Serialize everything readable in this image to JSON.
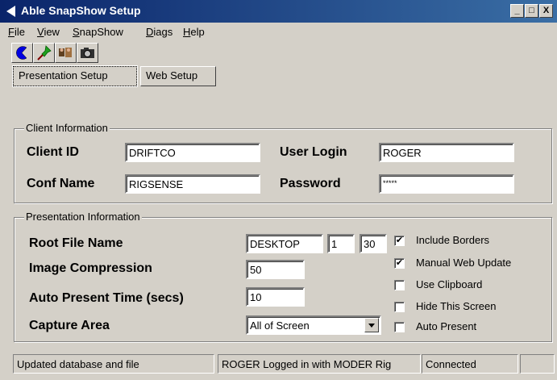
{
  "window": {
    "title": "Able SnapShow Setup",
    "controls": {
      "minimize": "_",
      "maximize": "□",
      "close": "X"
    }
  },
  "menu": {
    "items": [
      {
        "pre": "",
        "ul": "F",
        "post": "ile"
      },
      {
        "pre": "",
        "ul": "V",
        "post": "iew"
      },
      {
        "pre": "",
        "ul": "S",
        "post": "napShow"
      },
      {
        "pre": "",
        "ul": "D",
        "post": "iags"
      },
      {
        "pre": "",
        "ul": "H",
        "post": "elp"
      }
    ]
  },
  "toolbar": {
    "icons": [
      "pacman-icon",
      "pushpin-icon",
      "people-icon",
      "camera-icon"
    ]
  },
  "tabs": {
    "presentation": "Presentation Setup",
    "web": "Web Setup"
  },
  "client": {
    "group_title": "Client Information",
    "client_id_label": "Client ID",
    "client_id_value": "DRIFTCO",
    "conf_name_label": "Conf Name",
    "conf_name_value": "RIGSENSE",
    "user_login_label": "User Login",
    "user_login_value": "ROGER",
    "password_label": "Password",
    "password_value": "*****"
  },
  "presentation": {
    "group_title": "Presentation Information",
    "root_file_label": "Root File Name",
    "root_file_value": "DESKTOP",
    "root_file_num1": "1",
    "root_file_num2": "30",
    "compression_label": "Image Compression",
    "compression_value": "50",
    "auto_time_label": "Auto Present Time (secs)",
    "auto_time_value": "10",
    "capture_label": "Capture Area",
    "capture_value": "All of Screen",
    "checkboxes": [
      {
        "label": "Include Borders",
        "checked": true,
        "mark": "✔"
      },
      {
        "label": "Manual Web Update",
        "checked": true,
        "mark": "✔"
      },
      {
        "label": "Use Clipboard",
        "checked": false,
        "mark": ""
      },
      {
        "label": "Hide This Screen",
        "checked": false,
        "mark": ""
      },
      {
        "label": "Auto Present",
        "checked": false,
        "mark": ""
      }
    ]
  },
  "status": {
    "pane1": "Updated database and file",
    "pane2": "ROGER Logged in with MODER Rig",
    "pane3": "Connected",
    "pane4": ""
  },
  "colors": {
    "titlebar_start": "#0a246a",
    "titlebar_end": "#3a6ea5",
    "face": "#d4d0c8"
  }
}
